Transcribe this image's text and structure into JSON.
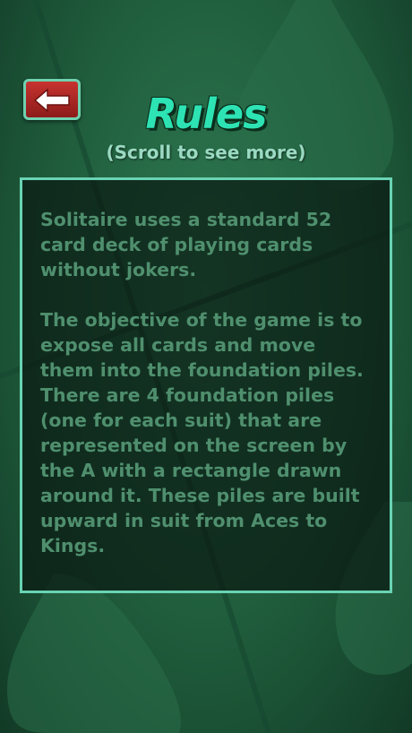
{
  "header": {
    "back_icon": "left-arrow-icon",
    "title": "Rules",
    "subtitle": "(Scroll to see more)"
  },
  "rules": {
    "paragraphs": [
      "Solitaire uses a standard 52 card deck of playing cards without jokers.",
      "The objective of the game is to expose all cards and move them into the foundation piles. There are 4 foundation piles (one for each suit) that are represented on the screen by the A with a rectangle drawn around it. These piles are built upward in suit from Aces to Kings."
    ]
  },
  "colors": {
    "background": "#1f5c3c",
    "title": "#2de3b4",
    "panel_border": "#69d3b3",
    "back_button": "#c7332f",
    "rules_text": "#4f8f6e"
  }
}
